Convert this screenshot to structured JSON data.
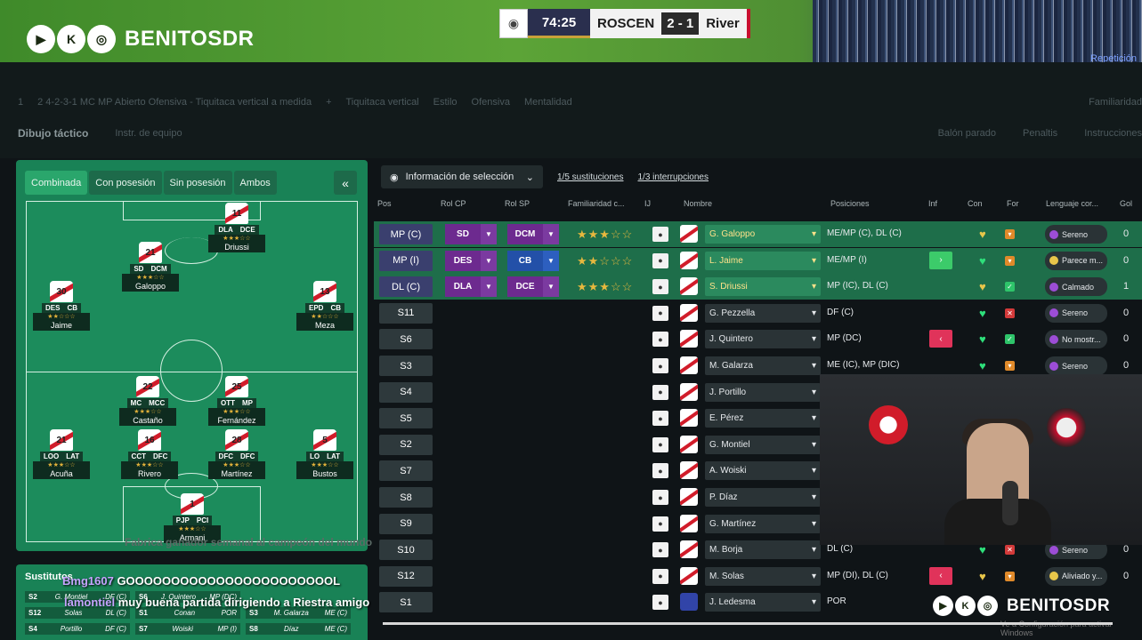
{
  "brand": {
    "name": "BENITOSDR",
    "icons": [
      "youtube-icon",
      "kick-icon",
      "instagram-icon"
    ],
    "icon_glyphs": [
      "▶",
      "K",
      "◎"
    ]
  },
  "scoreboard": {
    "time": "74:25",
    "home": "ROSCEN",
    "score": "2 - 1",
    "away": "River"
  },
  "repeat_label": "Repetición",
  "toolbar": {
    "formation_num": "1",
    "formation": "2 4-2-3-1 MC MP Abierto Ofensiva - Tiquitaca vertical a medida",
    "style": "Tiquitaca vertical",
    "style_b": "Estilo",
    "mentality": "Ofensiva",
    "mentality_b": "Mentalidad",
    "familiarity": "Familiaridad",
    "tab_active": "Dibujo táctico",
    "tab_other": "Instr. de equipo",
    "set_pieces": "Balón parado",
    "penalties": "Penaltis",
    "instructions": "Instrucciones"
  },
  "tabs": [
    "Combinada",
    "Con posesión",
    "Sin posesión",
    "Ambos"
  ],
  "collapse": "«",
  "players": [
    {
      "num": "11",
      "roles": [
        "DLA",
        "DCE"
      ],
      "stars": "★★★☆☆",
      "name": "Driussi"
    },
    {
      "num": "21",
      "roles": [
        "SD",
        "DCM"
      ],
      "stars": "★★★☆☆",
      "name": "Galoppo"
    },
    {
      "num": "30",
      "roles": [
        "DES",
        "CB"
      ],
      "stars": "★★☆☆☆",
      "name": "Jaime"
    },
    {
      "num": "13",
      "roles": [
        "EPD",
        "CB"
      ],
      "stars": "★★☆☆☆",
      "name": "Meza"
    },
    {
      "num": "22",
      "roles": [
        "MC",
        "MCC"
      ],
      "stars": "★★★☆☆",
      "name": "Castaño"
    },
    {
      "num": "25",
      "roles": [
        "OTT",
        "MP"
      ],
      "stars": "★★★☆☆",
      "name": "Fernández"
    },
    {
      "num": "21",
      "roles": [
        "LOO",
        "LAT"
      ],
      "stars": "★★★☆☆",
      "name": "Acuña"
    },
    {
      "num": "16",
      "roles": [
        "CCT",
        "DFC"
      ],
      "stars": "★★★☆☆",
      "name": "Rivero"
    },
    {
      "num": "28",
      "roles": [
        "DFC",
        "DFC"
      ],
      "stars": "★★★☆☆",
      "name": "Martínez"
    },
    {
      "num": "5",
      "roles": [
        "LO",
        "LAT"
      ],
      "stars": "★★★☆☆",
      "name": "Bustos"
    },
    {
      "num": "1",
      "roles": [
        "PJP",
        "PCI"
      ],
      "stars": "★★★☆☆",
      "name": "Armani"
    }
  ],
  "subs": {
    "title": "Sustitutos",
    "rows": [
      [
        [
          "S2",
          "G. Montiel",
          "DF (C)"
        ],
        [
          "S6",
          "J. Quintero",
          "MP (DC)"
        ]
      ],
      [
        [
          "S12",
          "Solas",
          "DL (C)"
        ],
        [
          "S1",
          "Conan",
          "POR"
        ],
        [
          "S3",
          "M. Galarza",
          "ME (C)"
        ]
      ],
      [
        [
          "S4",
          "Portillo",
          "DF (C)"
        ],
        [
          "S7",
          "Woiski",
          "MP (I)"
        ],
        [
          "S8",
          "Díaz",
          "ME (C)"
        ]
      ]
    ]
  },
  "chat": [
    {
      "user": "Bmg1607",
      "msg": "GOOOOOOOOOOOOOOOOOOOOOOOL"
    },
    {
      "user": "lamontiel",
      "msg": "muy buena partida dirigiendo a Riestra amigo"
    }
  ],
  "chat_faded": "Fabrica ganador semanal al campeón del mundo",
  "selection": {
    "label": "Información de selección",
    "subs": "1/5 sustituciones",
    "interrupts": "1/3 interrupciones"
  },
  "columns": {
    "pos": "Pos",
    "rol_cp": "Rol CP",
    "rol_sp": "Rol SP",
    "fam": "Familiaridad c...",
    "ij": "IJ",
    "name": "Nombre",
    "positions": "Posiciones",
    "inf": "Inf",
    "con": "Con",
    "for": "For",
    "lang": "Lenguaje cor...",
    "gol": "Gol"
  },
  "rows": [
    {
      "pos": "MP (C)",
      "cp": "SD",
      "sp": "DCM",
      "sp_color": "purple",
      "fam": "★★★☆☆",
      "name": "G. Galoppo",
      "positions": "ME/MP (C), DL (C)",
      "inf": "",
      "heart": "y",
      "form": "o",
      "lang": "Sereno",
      "lang_dot": "p",
      "gol": "0",
      "hl": true
    },
    {
      "pos": "MP (I)",
      "cp": "DES",
      "sp": "CB",
      "sp_color": "blue",
      "fam": "★★☆☆☆",
      "name": "L. Jaime",
      "positions": "ME/MP (I)",
      "inf": "›",
      "inf_color": "#3ccb6a",
      "heart": "g",
      "form": "o",
      "lang": "Parece m...",
      "lang_dot": "y",
      "gol": "0",
      "hl": true
    },
    {
      "pos": "DL (C)",
      "cp": "DLA",
      "sp": "DCE",
      "sp_color": "purple",
      "fam": "★★★☆☆",
      "name": "S. Driussi",
      "positions": "MP (IC), DL (C)",
      "inf": "",
      "heart": "y",
      "form": "g",
      "lang": "Calmado",
      "lang_dot": "p",
      "gol": "1",
      "hl": true
    },
    {
      "pos": "S11",
      "name": "G. Pezzella",
      "positions": "DF (C)",
      "heart": "g",
      "form": "r",
      "lang": "Sereno",
      "lang_dot": "p",
      "gol": "0"
    },
    {
      "pos": "S6",
      "name": "J. Quintero",
      "positions": "MP (DC)",
      "inf": "‹",
      "inf_color": "#e0335a",
      "heart": "g",
      "form": "g",
      "lang": "No mostr...",
      "lang_dot": "p",
      "gol": "0"
    },
    {
      "pos": "S3",
      "name": "M. Galarza",
      "positions": "ME (IC), MP (DIC)",
      "heart": "g",
      "form": "o",
      "lang": "Sereno",
      "lang_dot": "p",
      "gol": "0"
    },
    {
      "pos": "S4",
      "name": "J. Portillo"
    },
    {
      "pos": "S5",
      "name": "E. Pérez"
    },
    {
      "pos": "S2",
      "name": "G. Montiel"
    },
    {
      "pos": "S7",
      "name": "A. Woiski"
    },
    {
      "pos": "S8",
      "name": "P. Díaz"
    },
    {
      "pos": "S9",
      "name": "G. Martínez"
    },
    {
      "pos": "S10",
      "name": "M. Borja",
      "positions": "DL (C)",
      "heart": "g",
      "form": "r",
      "lang": "Sereno",
      "lang_dot": "p",
      "gol": "0"
    },
    {
      "pos": "S12",
      "name": "M. Solas",
      "positions": "MP (DI), DL (C)",
      "inf": "‹",
      "inf_color": "#e0335a",
      "heart": "y",
      "form": "o",
      "lang": "Aliviado y...",
      "lang_dot": "y",
      "gol": "0"
    },
    {
      "pos": "S1",
      "name": "J. Ledesma",
      "positions": "POR",
      "gk": true
    }
  ],
  "activate_text": "Ve a Configuración para activar Windows"
}
